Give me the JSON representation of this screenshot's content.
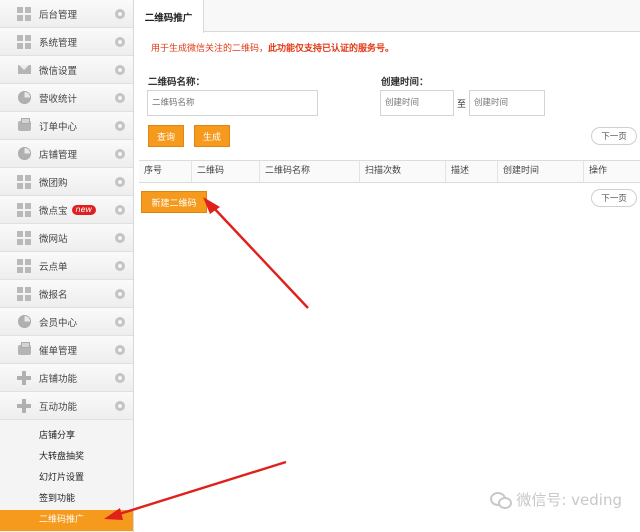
{
  "sidebar": {
    "items": [
      {
        "label": "后台管理",
        "icon": "grid-icon"
      },
      {
        "label": "系统管理",
        "icon": "grid-icon"
      },
      {
        "label": "微信设置",
        "icon": "envelope-icon"
      },
      {
        "label": "营收统计",
        "icon": "pie-icon"
      },
      {
        "label": "订单中心",
        "icon": "printer-icon"
      },
      {
        "label": "店铺管理",
        "icon": "pie-icon"
      },
      {
        "label": "微团购",
        "icon": "grid-icon"
      },
      {
        "label": "微点宝",
        "icon": "grid-icon",
        "badge": "new"
      },
      {
        "label": "微网站",
        "icon": "grid-icon"
      },
      {
        "label": "云点单",
        "icon": "grid-icon"
      },
      {
        "label": "微报名",
        "icon": "grid-icon"
      },
      {
        "label": "会员中心",
        "icon": "pie-icon"
      },
      {
        "label": "催单管理",
        "icon": "printer-icon"
      },
      {
        "label": "店铺功能",
        "icon": "plus-icon"
      },
      {
        "label": "互动功能",
        "icon": "plus-icon"
      }
    ],
    "subitems": [
      {
        "label": "店铺分享"
      },
      {
        "label": "大转盘抽奖"
      },
      {
        "label": "幻灯片设置"
      },
      {
        "label": "签到功能"
      },
      {
        "label": "二维码推广",
        "active": true
      }
    ]
  },
  "header": {
    "tab": "二维码推广"
  },
  "notice": {
    "prefix": "用于生成微信关注的二维码，",
    "emphasis": "此功能仅支持已认证的服务号。"
  },
  "form": {
    "name_label": "二维码名称：",
    "name_placeholder": "二维码名称",
    "time_label": "创建时间：",
    "time_start_placeholder": "创建时间",
    "time_sep": "至",
    "time_end_placeholder": "创建时间",
    "query_button": "查询",
    "export_button": "生成"
  },
  "pager": {
    "next_top": "下一页",
    "next_bottom": "下一页"
  },
  "table": {
    "columns": [
      "序号",
      "二维码",
      "二维码名称",
      "扫描次数",
      "描述",
      "创建时间",
      "操作"
    ]
  },
  "actions": {
    "new_qr": "新建二维码"
  },
  "watermark": {
    "text": "微信号: veding"
  },
  "colors": {
    "accent": "#f59a1d",
    "notice": "#e23a16",
    "arrow": "#e0201a"
  }
}
